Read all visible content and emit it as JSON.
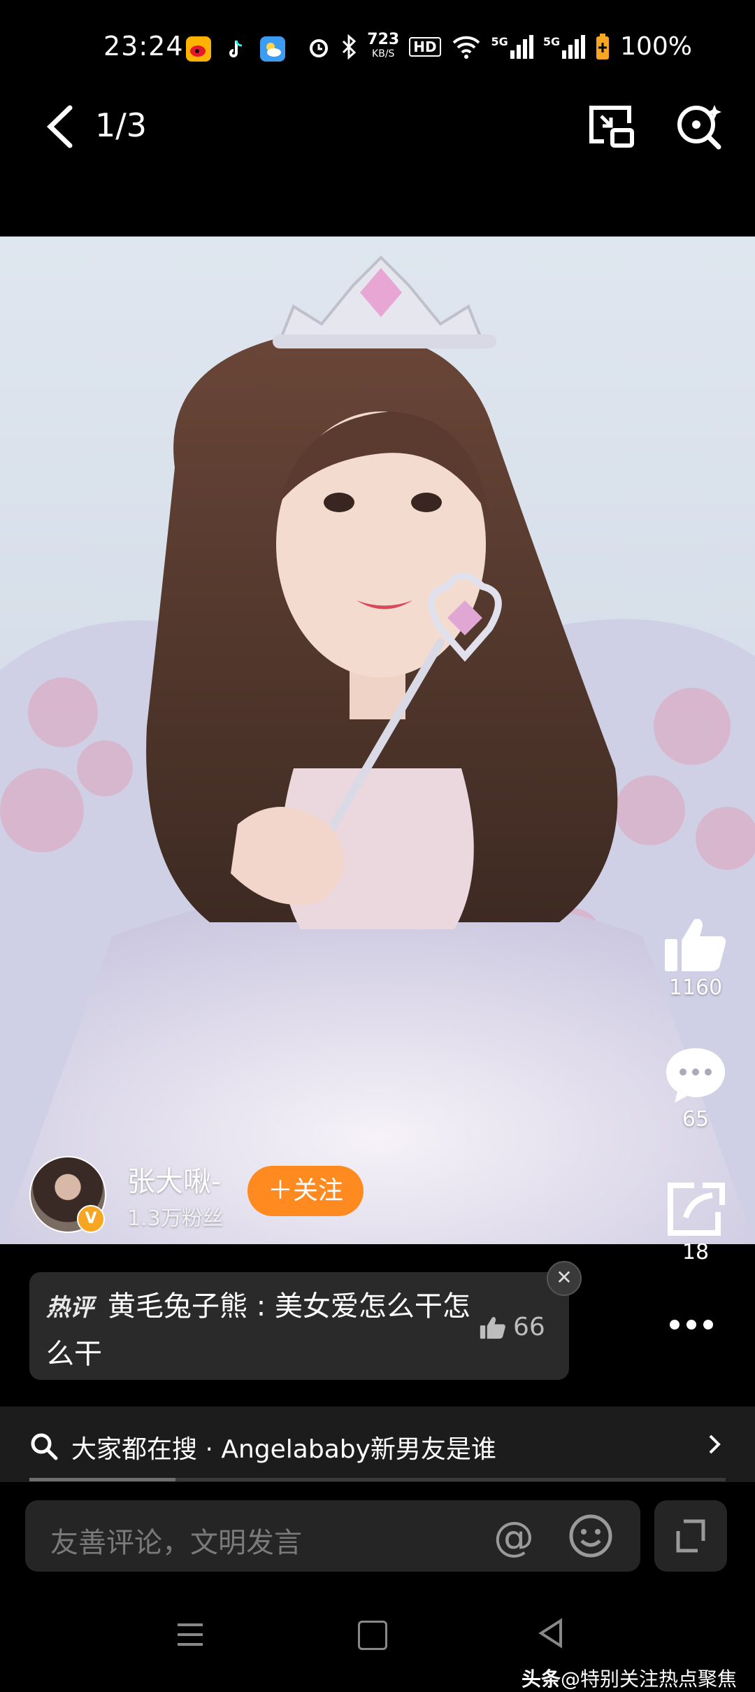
{
  "status_bar": {
    "time": "23:24",
    "speed_value": "723",
    "speed_unit": "KB/S",
    "hd_label": "HD",
    "net1": "5G",
    "net2": "5G",
    "battery": "100%",
    "icons": [
      "weibo-icon",
      "tiktok-icon",
      "weather-icon",
      "alarm-icon",
      "bluetooth-icon",
      "wifi-icon",
      "signal-icon",
      "battery-icon"
    ]
  },
  "nav": {
    "counter": "1/3",
    "icons": [
      "back-icon",
      "picture-in-picture-icon",
      "lens-search-icon"
    ]
  },
  "actions": {
    "likes": "1160",
    "comments": "65",
    "shares": "18"
  },
  "author": {
    "name": "张大啾-",
    "fans": "1.3万粉丝",
    "verified": "V",
    "follow_label": "＋关注"
  },
  "hot_comment": {
    "tag": "热评",
    "text": "黄毛兔子熊 : 美女爱怎么干怎么干",
    "likes": "66",
    "close": "✕"
  },
  "search": {
    "text": "大家都在搜 · Angelababy新男友是谁",
    "progress_fraction": 0.21
  },
  "comment_bar": {
    "placeholder": "友善评论，文明发言",
    "at": "@"
  },
  "watermark": {
    "brand": "头条",
    "handle": "@特别关注热点聚焦"
  }
}
